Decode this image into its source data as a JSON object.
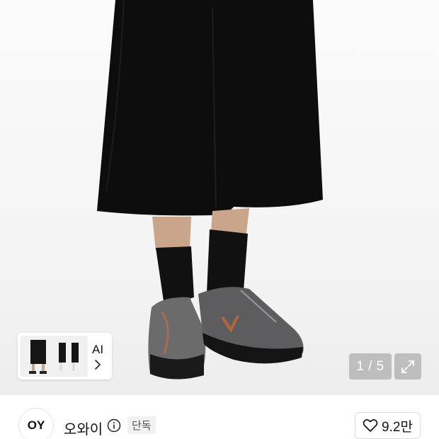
{
  "gallery": {
    "counter": "1 / 5",
    "expand_icon": "expand-icon"
  },
  "ai_recommend": {
    "label": "AI",
    "chevron_icon": "chevron-right-icon"
  },
  "brand": {
    "logo_text": "OY",
    "name": "오와이",
    "info_icon": "info-icon",
    "badge": "단독"
  },
  "like": {
    "icon": "heart-icon",
    "count": "9.2만"
  }
}
